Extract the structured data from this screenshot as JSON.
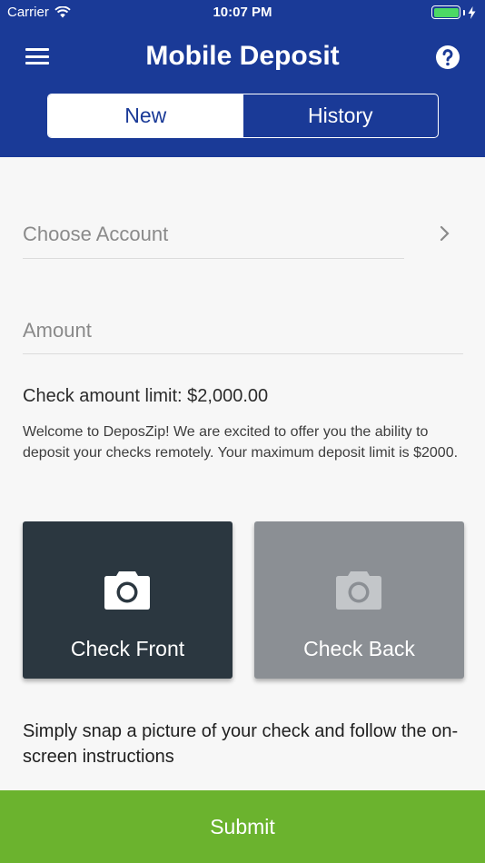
{
  "status_bar": {
    "carrier": "Carrier",
    "time": "10:07 PM",
    "battery_color": "#4cd964"
  },
  "header": {
    "title": "Mobile Deposit",
    "menu_icon": "hamburger-menu-icon",
    "help_icon": "question-circle-icon",
    "background": "#1a3a97"
  },
  "tabs": [
    {
      "label": "New",
      "active": true
    },
    {
      "label": "History",
      "active": false
    }
  ],
  "form": {
    "account_placeholder": "Choose Account",
    "amount_placeholder": "Amount",
    "limit_text": "Check amount limit: $2,000.00",
    "welcome_text": "Welcome to DeposZip! We are excited to offer you the ability to deposit your checks remotely. Your maximum deposit limit is $2000."
  },
  "capture": {
    "front_label": "Check Front",
    "back_label": "Check Back",
    "icon": "camera-icon"
  },
  "instructions": "Simply snap a picture of your check and follow the on-screen instructions",
  "submit_label": "Submit",
  "colors": {
    "accent": "#1a3a97",
    "submit": "#6bb32e",
    "front_card": "#2b3740",
    "back_card": "#8b8f94"
  }
}
